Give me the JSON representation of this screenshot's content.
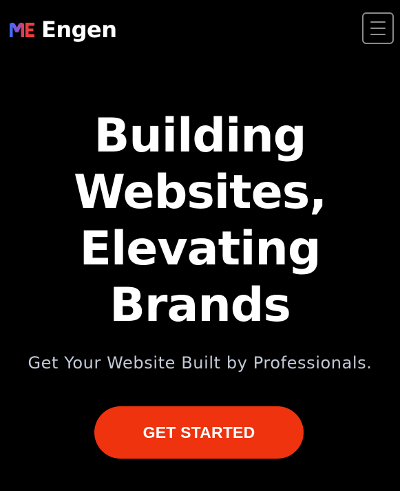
{
  "header": {
    "logo_icon": "me-logo-icon",
    "brand_name": "Engen",
    "menu_icon": "hamburger-menu-icon"
  },
  "hero": {
    "title_lines": [
      "Building",
      "Websites,",
      "Elevating",
      "Brands"
    ],
    "subtitle": "Get Your Website Built by Professionals.",
    "cta_label": "GET STARTED"
  },
  "colors": {
    "background": "#000000",
    "text": "#ffffff",
    "subtitle": "#c3cad8",
    "cta": "#f0330f",
    "logo_blue": "#3b6ef6",
    "logo_red": "#ef3b3b"
  }
}
